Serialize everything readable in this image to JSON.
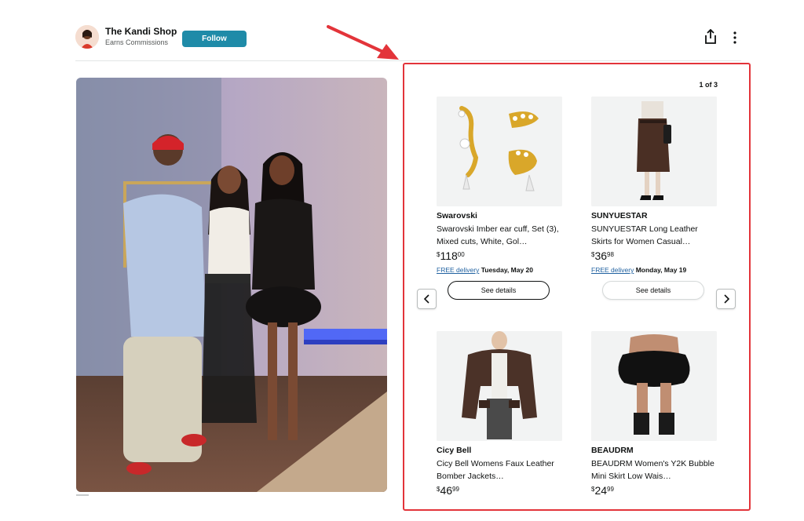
{
  "header": {
    "shop_name": "The Kandi Shop",
    "shop_subtitle": "Earns Commissions",
    "follow_label": "Follow",
    "avatar_icon": "avatar-photo",
    "share_icon": "share-icon",
    "more_icon": "more-vertical-icon"
  },
  "colors": {
    "follow_bg": "#1f8ba8",
    "highlight_border": "#e3343a",
    "link_blue": "#2162a1"
  },
  "carousel": {
    "page_indicator": "1 of 3",
    "prev_icon": "chevron-left-icon",
    "next_icon": "chevron-right-icon",
    "products": [
      {
        "brand": "Swarovski",
        "title": "Swarovski Imber ear cuff, Set (3), Mixed cuts, White, Gol…",
        "price_symbol": "$",
        "price_dollars": "118",
        "price_cents": "00",
        "delivery_free": "FREE delivery",
        "delivery_date": "Tuesday, May 20",
        "details_label": "See details",
        "image": "gold-ear-cuffs"
      },
      {
        "brand": "SUNYUESTAR",
        "title": "SUNYUESTAR Long Leather Skirts for Women Casual…",
        "price_symbol": "$",
        "price_dollars": "36",
        "price_cents": "98",
        "delivery_free": "FREE delivery",
        "delivery_date": "Monday, May 19",
        "details_label": "See details",
        "image": "brown-leather-skirt"
      },
      {
        "brand": "Cicy Bell",
        "title": "Cicy Bell Womens Faux Leather Bomber Jackets…",
        "price_symbol": "$",
        "price_dollars": "46",
        "price_cents": "99",
        "image": "brown-bomber-jacket"
      },
      {
        "brand": "BEAUDRM",
        "title": "BEAUDRM Women's Y2K Bubble Mini Skirt Low Wais…",
        "price_symbol": "$",
        "price_dollars": "24",
        "price_cents": "99",
        "image": "black-bubble-skirt"
      }
    ]
  }
}
